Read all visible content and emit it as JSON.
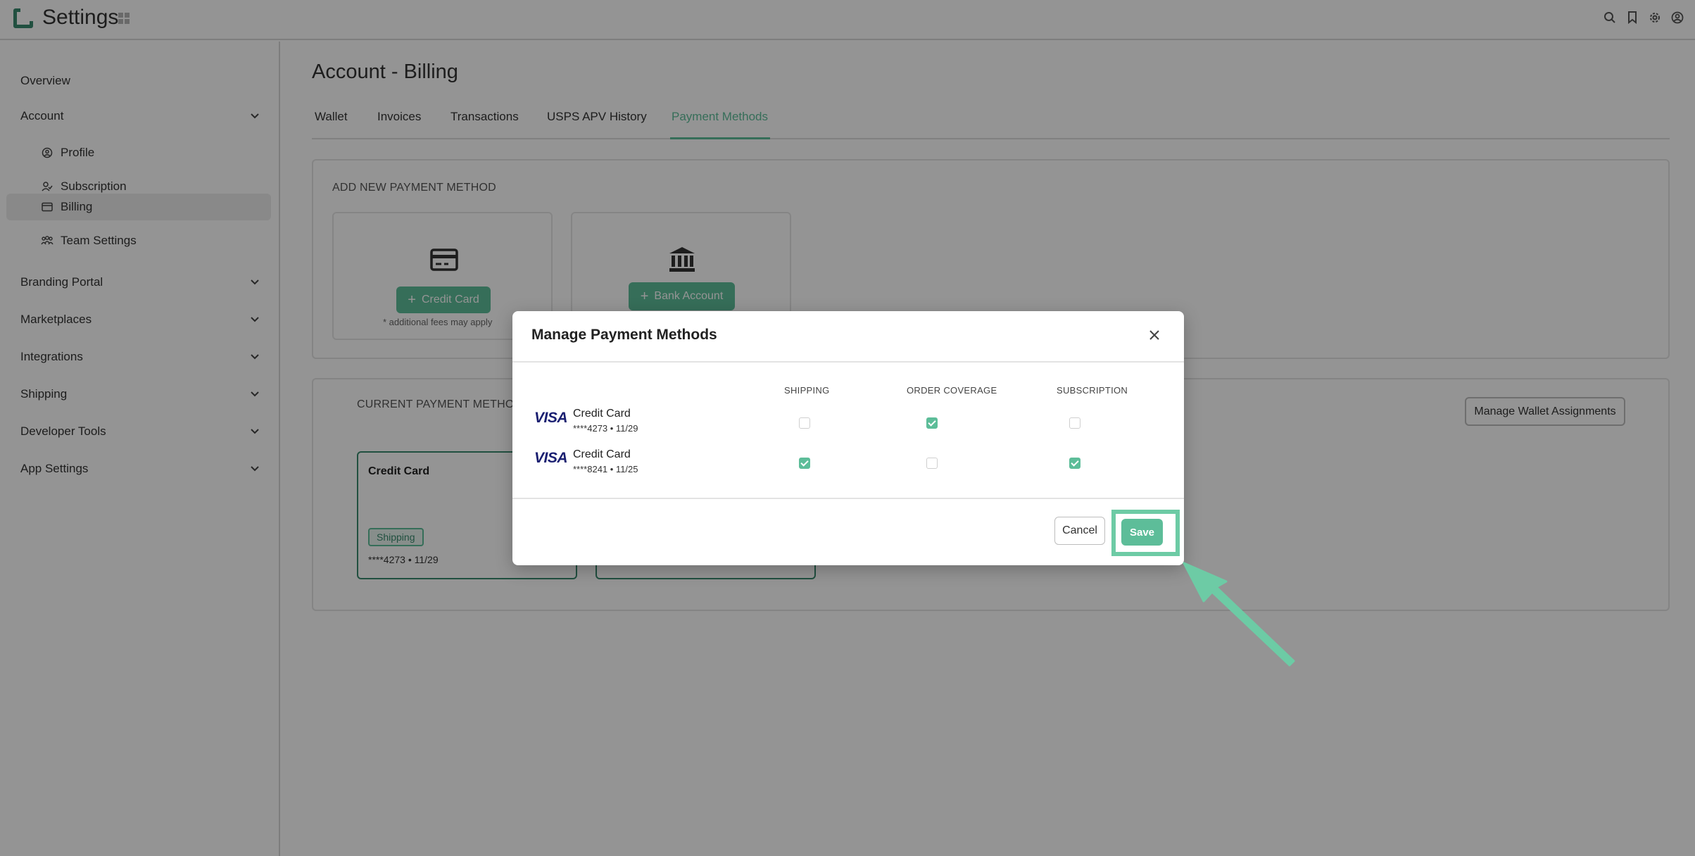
{
  "app": {
    "title": "Settings"
  },
  "sidebar": {
    "overview": "Overview",
    "account": "Account",
    "account_items": [
      {
        "label": "Profile",
        "icon": "user-circle-icon"
      },
      {
        "label": "Subscription",
        "icon": "user-check-icon"
      },
      {
        "label": "Billing",
        "icon": "credit-card-icon",
        "active": true
      },
      {
        "label": "Team Settings",
        "icon": "team-icon"
      }
    ],
    "sections": [
      "Branding Portal",
      "Marketplaces",
      "Integrations",
      "Shipping",
      "Developer Tools",
      "App Settings"
    ]
  },
  "main": {
    "title": "Account - Billing",
    "tabs": [
      "Wallet",
      "Invoices",
      "Transactions",
      "USPS APV History",
      "Payment Methods"
    ],
    "active_tab": "Payment Methods",
    "add_section_label": "ADD NEW PAYMENT METHOD",
    "add_credit_card": "Credit Card",
    "add_bank_account": "Bank Account",
    "fee_note": "* additional fees may apply",
    "current_section_label": "CURRENT PAYMENT METHOD",
    "manage_wallet_button": "Manage Wallet Assignments",
    "current_card": {
      "title": "Credit Card",
      "badge": "Shipping",
      "number": "****4273 • 11/29"
    }
  },
  "modal": {
    "title": "Manage Payment Methods",
    "columns": [
      "SHIPPING",
      "ORDER COVERAGE",
      "SUBSCRIPTION"
    ],
    "rows": [
      {
        "brand": "VISA",
        "title": "Credit Card",
        "number": "****4273 • 11/29",
        "shipping": false,
        "order_coverage": true,
        "subscription": false
      },
      {
        "brand": "VISA",
        "title": "Credit Card",
        "number": "****8241 • 11/25",
        "shipping": true,
        "order_coverage": false,
        "subscription": true
      }
    ],
    "cancel": "Cancel",
    "save": "Save"
  },
  "colors": {
    "accent": "#5dbd99",
    "brand_dark": "#3a8a6e",
    "highlight": "#6dcba5",
    "visa": "#1a1f71"
  }
}
